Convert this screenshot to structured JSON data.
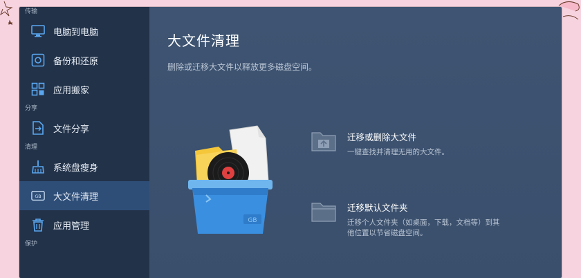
{
  "sidebar": {
    "sections": {
      "transfer": "传输",
      "share": "分享",
      "clean": "清理",
      "protect": "保护"
    },
    "items": [
      {
        "label": "电脑到电脑",
        "icon": "monitor-icon"
      },
      {
        "label": "备份和还原",
        "icon": "backup-restore-icon"
      },
      {
        "label": "应用搬家",
        "icon": "app-migrate-icon"
      },
      {
        "label": "文件分享",
        "icon": "file-share-icon"
      },
      {
        "label": "系统盘瘦身",
        "icon": "broom-icon"
      },
      {
        "label": "大文件清理",
        "icon": "gb-icon"
      },
      {
        "label": "应用管理",
        "icon": "trash-icon"
      }
    ],
    "active_index": 5
  },
  "main": {
    "title": "大文件清理",
    "subtitle": "删除或迁移大文件以释放更多磁盘空间。",
    "options": [
      {
        "title": "迁移或删除大文件",
        "desc": "一键查找并清理无用的大文件。",
        "icon": "folder-migrate-icon"
      },
      {
        "title": "迁移默认文件夹",
        "desc_line1": "迁移个人文件夹（如桌面，下载，文档等）到其",
        "desc_line2": "他位置以节省磁盘空间。",
        "icon": "folder-icon"
      }
    ],
    "hero_icon": "bin-with-files-icon",
    "hero_tag": "GB"
  },
  "colors": {
    "sidebar_bg": "#223249",
    "active_item_bg": "#2e4e78",
    "main_bg": "#3e5472",
    "bin_blue": "#3b8fe0"
  }
}
